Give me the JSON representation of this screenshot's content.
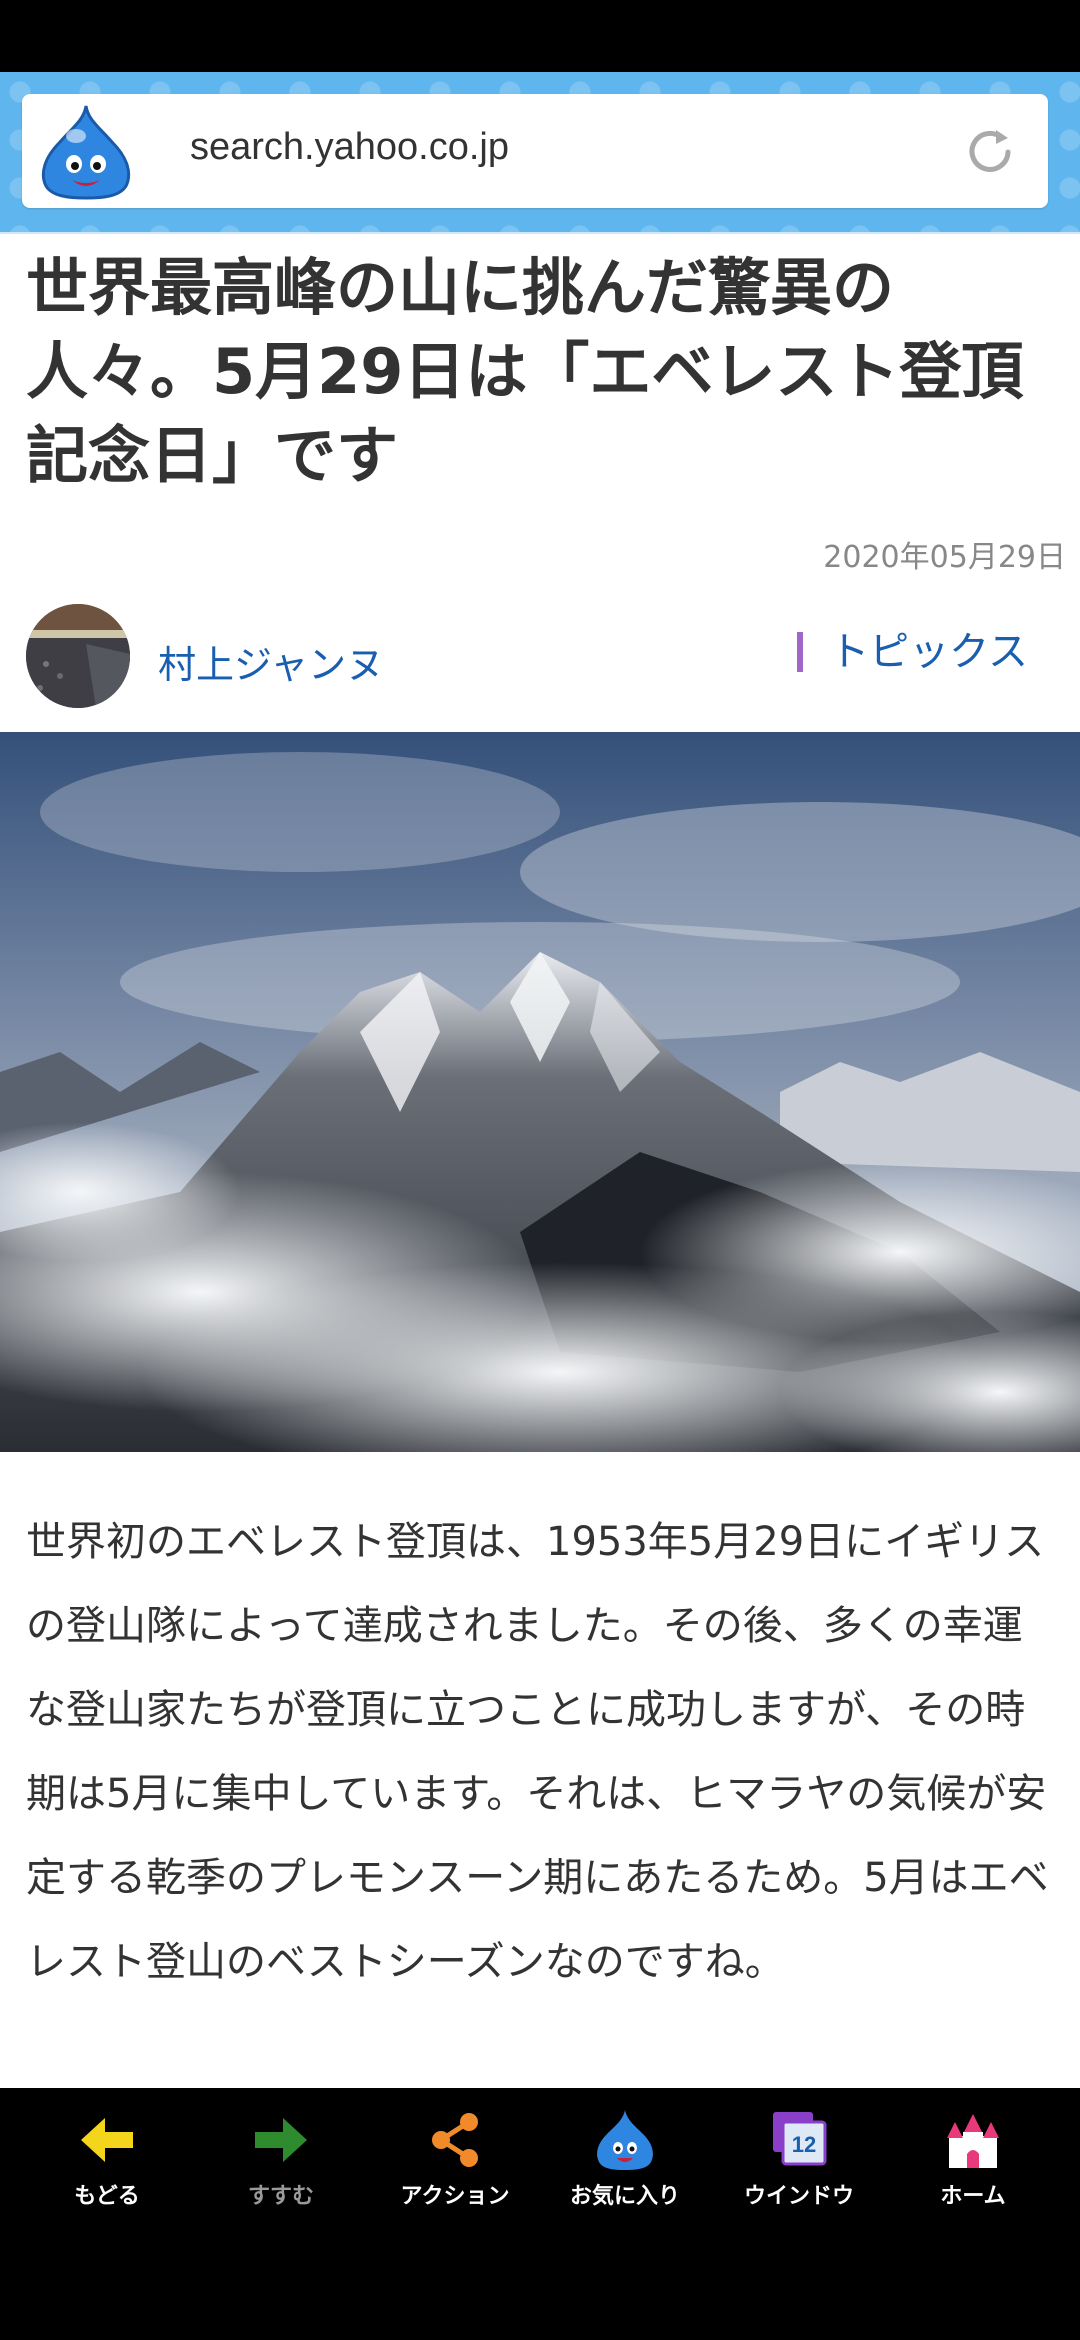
{
  "browser": {
    "url": "search.yahoo.co.jp",
    "logo_icon": "slime-icon",
    "reload_icon": "reload-icon"
  },
  "article": {
    "title": "世界最高峰の山に挑んだ驚異の人々。5月29日は「エベレスト登頂記念日」です",
    "date": "2020年05月29日",
    "author": "村上ジャンヌ",
    "category": "トピックス",
    "body": "世界初のエベレスト登頂は、1953年5月29日にイギリスの登山隊によって達成されました。その後、多くの幸運な登山家たちが登頂に立つことに成功しますが、その時期は5月に集中しています。それは、ヒマラヤの気候が安定する乾季のプレモンスーン期にあたるため。5月はエベレスト登山のベストシーズンなのですね。"
  },
  "toolbar": {
    "items": [
      {
        "label": "もどる",
        "icon": "back-arrow-icon"
      },
      {
        "label": "すすむ",
        "icon": "forward-arrow-icon"
      },
      {
        "label": "アクション",
        "icon": "share-icon"
      },
      {
        "label": "お気に入り",
        "icon": "slime-icon"
      },
      {
        "label": "ウインドウ",
        "icon": "window-icon",
        "badge": "12"
      },
      {
        "label": "ホーム",
        "icon": "castle-icon"
      }
    ]
  },
  "colors": {
    "header_bg": "#5fb6ee",
    "link": "#1a5eb0",
    "category_bar": "#a067c8",
    "back_arrow": "#f3d51b",
    "forward_arrow": "#2e8b2e",
    "share": "#f08a2a",
    "window": "#8a3fc8",
    "castle_roof": "#e83a7a"
  }
}
